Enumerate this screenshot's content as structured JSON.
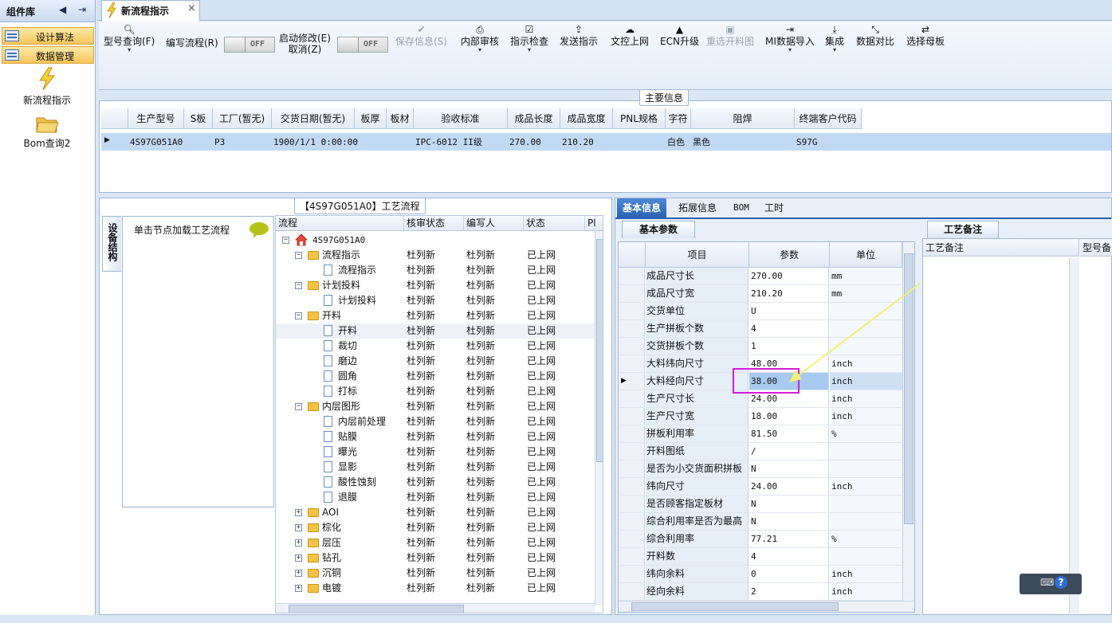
{
  "left_panel": {
    "title": "组件库",
    "buttons": [
      {
        "label": "设计算法"
      },
      {
        "label": "数据管理"
      }
    ],
    "items": [
      {
        "label": "新流程指示"
      },
      {
        "label": "Bom查询2"
      }
    ]
  },
  "tab": {
    "title": "新流程指示",
    "close": "×"
  },
  "toolbar": {
    "items": [
      {
        "label": "型号查询(F)",
        "icon": "search-icon",
        "has_dropdown": true,
        "enabled": true
      },
      {
        "label": "编写流程(R)",
        "icon": "",
        "has_dropdown": false,
        "enabled": true
      },
      {
        "label": "启动修改(E)",
        "label2": "取消(Z)",
        "enabled": true
      },
      {
        "label": "保存信息(S)",
        "icon": "check-icon",
        "enabled": false
      },
      {
        "label": "内部审核",
        "icon": "print-icon",
        "has_dropdown": true,
        "enabled": true
      },
      {
        "label": "指示检查",
        "icon": "checkbox-icon",
        "has_dropdown": true,
        "enabled": true
      },
      {
        "label": "发送指示",
        "icon": "upload-icon",
        "enabled": true
      },
      {
        "label": "文控上网",
        "icon": "cloud-upload-icon",
        "enabled": true
      },
      {
        "label": "ECN升级",
        "icon": "ecn-icon",
        "enabled": true
      },
      {
        "label": "重选开料图",
        "icon": "image-icon",
        "enabled": false
      },
      {
        "label": "MI数据导入",
        "icon": "import-icon",
        "has_dropdown": true,
        "enabled": true
      },
      {
        "label": "集成",
        "icon": "download-icon",
        "has_dropdown": true,
        "enabled": true
      },
      {
        "label": "数据对比",
        "icon": "compare-icon",
        "enabled": true
      },
      {
        "label": "选择母板",
        "icon": "shuffle-icon",
        "enabled": true
      }
    ],
    "toggle_off_label": "OFF"
  },
  "main_info": {
    "title": "主要信息",
    "columns": [
      "生产型号",
      "S板",
      "工厂(暂无)",
      "交货日期(暂无)",
      "板厚",
      "板材",
      "验收标准",
      "成品长度",
      "成品宽度",
      "PNL规格",
      "字符",
      "阻焊",
      "终端客户代码"
    ],
    "row": [
      "4S97G051A0",
      "",
      "P3",
      "1900/1/1 0:00:00",
      "",
      "",
      "IPC-6012 II级",
      "270.00",
      "210.20",
      "",
      "白色",
      "黑色",
      "S97G"
    ]
  },
  "workflow": {
    "title": "【4S97G051A0】工艺流程",
    "side_tab": "设备结构",
    "device_hint": "单击节点加载工艺流程",
    "columns": [
      "流程",
      "核审状态",
      "编写人",
      "状态",
      "Pl"
    ],
    "root": "4S97G051A0",
    "rows": [
      {
        "level": 1,
        "type": "folder",
        "name": "流程指示",
        "review": "杜列新",
        "author": "杜列新",
        "status": "已上网"
      },
      {
        "level": 2,
        "type": "doc",
        "name": "流程指示",
        "review": "杜列新",
        "author": "杜列新",
        "status": "已上网"
      },
      {
        "level": 1,
        "type": "folder",
        "name": "计划投料",
        "review": "杜列新",
        "author": "杜列新",
        "status": "已上网"
      },
      {
        "level": 2,
        "type": "doc",
        "name": "计划投料",
        "review": "杜列新",
        "author": "杜列新",
        "status": "已上网"
      },
      {
        "level": 1,
        "type": "folder",
        "name": "开料",
        "review": "杜列新",
        "author": "杜列新",
        "status": "已上网"
      },
      {
        "level": 2,
        "type": "doc",
        "name": "开料",
        "review": "杜列新",
        "author": "杜列新",
        "status": "已上网",
        "selected": true
      },
      {
        "level": 2,
        "type": "doc",
        "name": "裁切",
        "review": "杜列新",
        "author": "杜列新",
        "status": "已上网"
      },
      {
        "level": 2,
        "type": "doc",
        "name": "磨边",
        "review": "杜列新",
        "author": "杜列新",
        "status": "已上网"
      },
      {
        "level": 2,
        "type": "doc",
        "name": "圆角",
        "review": "杜列新",
        "author": "杜列新",
        "status": "已上网"
      },
      {
        "level": 2,
        "type": "doc",
        "name": "打标",
        "review": "杜列新",
        "author": "杜列新",
        "status": "已上网"
      },
      {
        "level": 1,
        "type": "folder",
        "name": "内层图形",
        "review": "杜列新",
        "author": "杜列新",
        "status": "已上网"
      },
      {
        "level": 2,
        "type": "doc",
        "name": "内层前处理",
        "review": "杜列新",
        "author": "杜列新",
        "status": "已上网"
      },
      {
        "level": 2,
        "type": "doc",
        "name": "贴膜",
        "review": "杜列新",
        "author": "杜列新",
        "status": "已上网"
      },
      {
        "level": 2,
        "type": "doc",
        "name": "曝光",
        "review": "杜列新",
        "author": "杜列新",
        "status": "已上网"
      },
      {
        "level": 2,
        "type": "doc",
        "name": "显影",
        "review": "杜列新",
        "author": "杜列新",
        "status": "已上网"
      },
      {
        "level": 2,
        "type": "doc",
        "name": "酸性蚀刻",
        "review": "杜列新",
        "author": "杜列新",
        "status": "已上网"
      },
      {
        "level": 2,
        "type": "doc",
        "name": "退膜",
        "review": "杜列新",
        "author": "杜列新",
        "status": "已上网"
      },
      {
        "level": 1,
        "type": "folder",
        "name": "AOI",
        "review": "杜列新",
        "author": "杜列新",
        "status": "已上网",
        "collapsed": true
      },
      {
        "level": 1,
        "type": "folder",
        "name": "棕化",
        "review": "杜列新",
        "author": "杜列新",
        "status": "已上网",
        "collapsed": true
      },
      {
        "level": 1,
        "type": "folder",
        "name": "层压",
        "review": "杜列新",
        "author": "杜列新",
        "status": "已上网",
        "collapsed": true
      },
      {
        "level": 1,
        "type": "folder",
        "name": "钻孔",
        "review": "杜列新",
        "author": "杜列新",
        "status": "已上网",
        "collapsed": true
      },
      {
        "level": 1,
        "type": "folder",
        "name": "沉铜",
        "review": "杜列新",
        "author": "杜列新",
        "status": "已上网",
        "collapsed": true
      },
      {
        "level": 1,
        "type": "folder",
        "name": "电镀",
        "review": "杜列新",
        "author": "杜列新",
        "status": "已上网",
        "collapsed": true
      }
    ]
  },
  "right_panel": {
    "tabs": [
      "基本信息",
      "拓展信息",
      "BOM",
      "工时"
    ],
    "sub_tab": "基本参数",
    "remarks_tab": "工艺备注",
    "param_columns": [
      "项目",
      "参数",
      "单位"
    ],
    "remarks_columns": [
      "工艺备注",
      "型号备"
    ],
    "params": [
      {
        "k": "成品尺寸长",
        "v": "270.00",
        "u": "mm"
      },
      {
        "k": "成品尺寸宽",
        "v": "210.20",
        "u": "mm"
      },
      {
        "k": "交货单位",
        "v": "U",
        "u": ""
      },
      {
        "k": "生产拼板个数",
        "v": "4",
        "u": ""
      },
      {
        "k": "交货拼板个数",
        "v": "1",
        "u": ""
      },
      {
        "k": "大料纬向尺寸",
        "v": "48.00",
        "u": "inch"
      },
      {
        "k": "大料经向尺寸",
        "v": "38.00",
        "u": "inch",
        "current": true
      },
      {
        "k": "生产尺寸长",
        "v": "24.00",
        "u": "inch"
      },
      {
        "k": "生产尺寸宽",
        "v": "18.00",
        "u": "inch"
      },
      {
        "k": "拼板利用率",
        "v": "81.50",
        "u": "%"
      },
      {
        "k": "开料图纸",
        "v": "/",
        "u": ""
      },
      {
        "k": "是否为小交货面积拼板",
        "v": "N",
        "u": ""
      },
      {
        "k": "纬向尺寸",
        "v": "24.00",
        "u": "inch"
      },
      {
        "k": "是否顾客指定板材",
        "v": "N",
        "u": ""
      },
      {
        "k": "综合利用率是否为最高",
        "v": "N",
        "u": ""
      },
      {
        "k": "综合利用率",
        "v": "77.21",
        "u": "%"
      },
      {
        "k": "开料数",
        "v": "4",
        "u": ""
      },
      {
        "k": "纬向余料",
        "v": "0",
        "u": "inch"
      },
      {
        "k": "经向余料",
        "v": "2",
        "u": "inch"
      }
    ]
  },
  "colors": {
    "accent": "#2a63b1",
    "highlight_box": "#d21ed8",
    "arrow": "#f0f07a"
  }
}
